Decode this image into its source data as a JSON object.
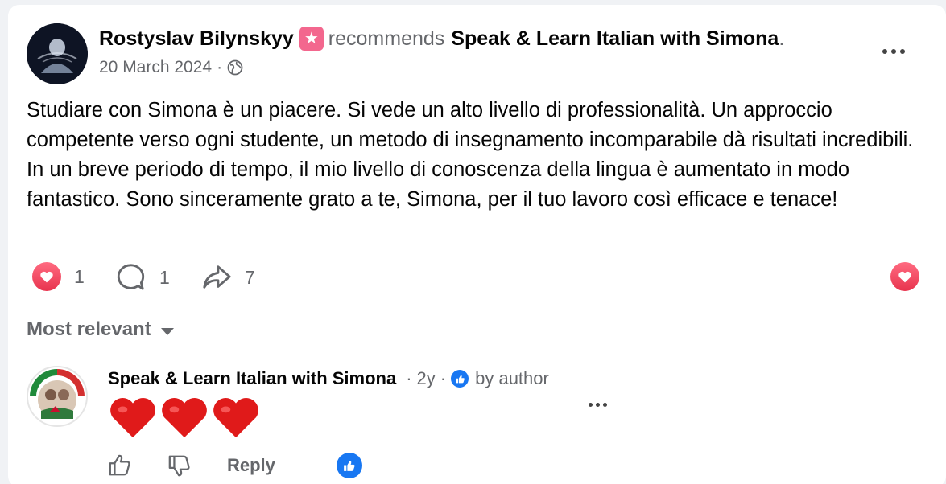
{
  "post": {
    "author": "Rostyslav Bilynskyy",
    "recommend_badge_icon": "star-badge-icon",
    "verb": "recommends",
    "page_name": "Speak & Learn Italian with Simona",
    "end_punct": ".",
    "date": "20 March 2024",
    "date_sep": "·",
    "audience_icon": "globe-icon",
    "text": "Studiare con Simona è un piacere. Si vede un alto livello di professionalità. Un approccio competente verso ogni studente, un metodo di insegnamento incomparabile dà risultati incredibili. In un breve periodo di tempo, il mio livello di conoscenza della lingua è aumentato in modo fantastico. Sono sinceramente grato a te, Simona, per il tuo lavoro così efficace e tenace!"
  },
  "stats": {
    "reactions": "1",
    "comments": "1",
    "shares": "7"
  },
  "comments_filter": {
    "label": "Most relevant"
  },
  "comment": {
    "author": "Speak & Learn Italian with Simona",
    "age": "2y",
    "sep": "·",
    "by_author": "by author",
    "content_icons": [
      "heart-emoji",
      "heart-emoji",
      "heart-emoji"
    ],
    "reply_label": "Reply"
  },
  "colors": {
    "text_primary": "#050505",
    "text_secondary": "#65676b",
    "love": "#e8344e",
    "like_blue": "#1877f2",
    "badge_pink": "#f3678e"
  }
}
